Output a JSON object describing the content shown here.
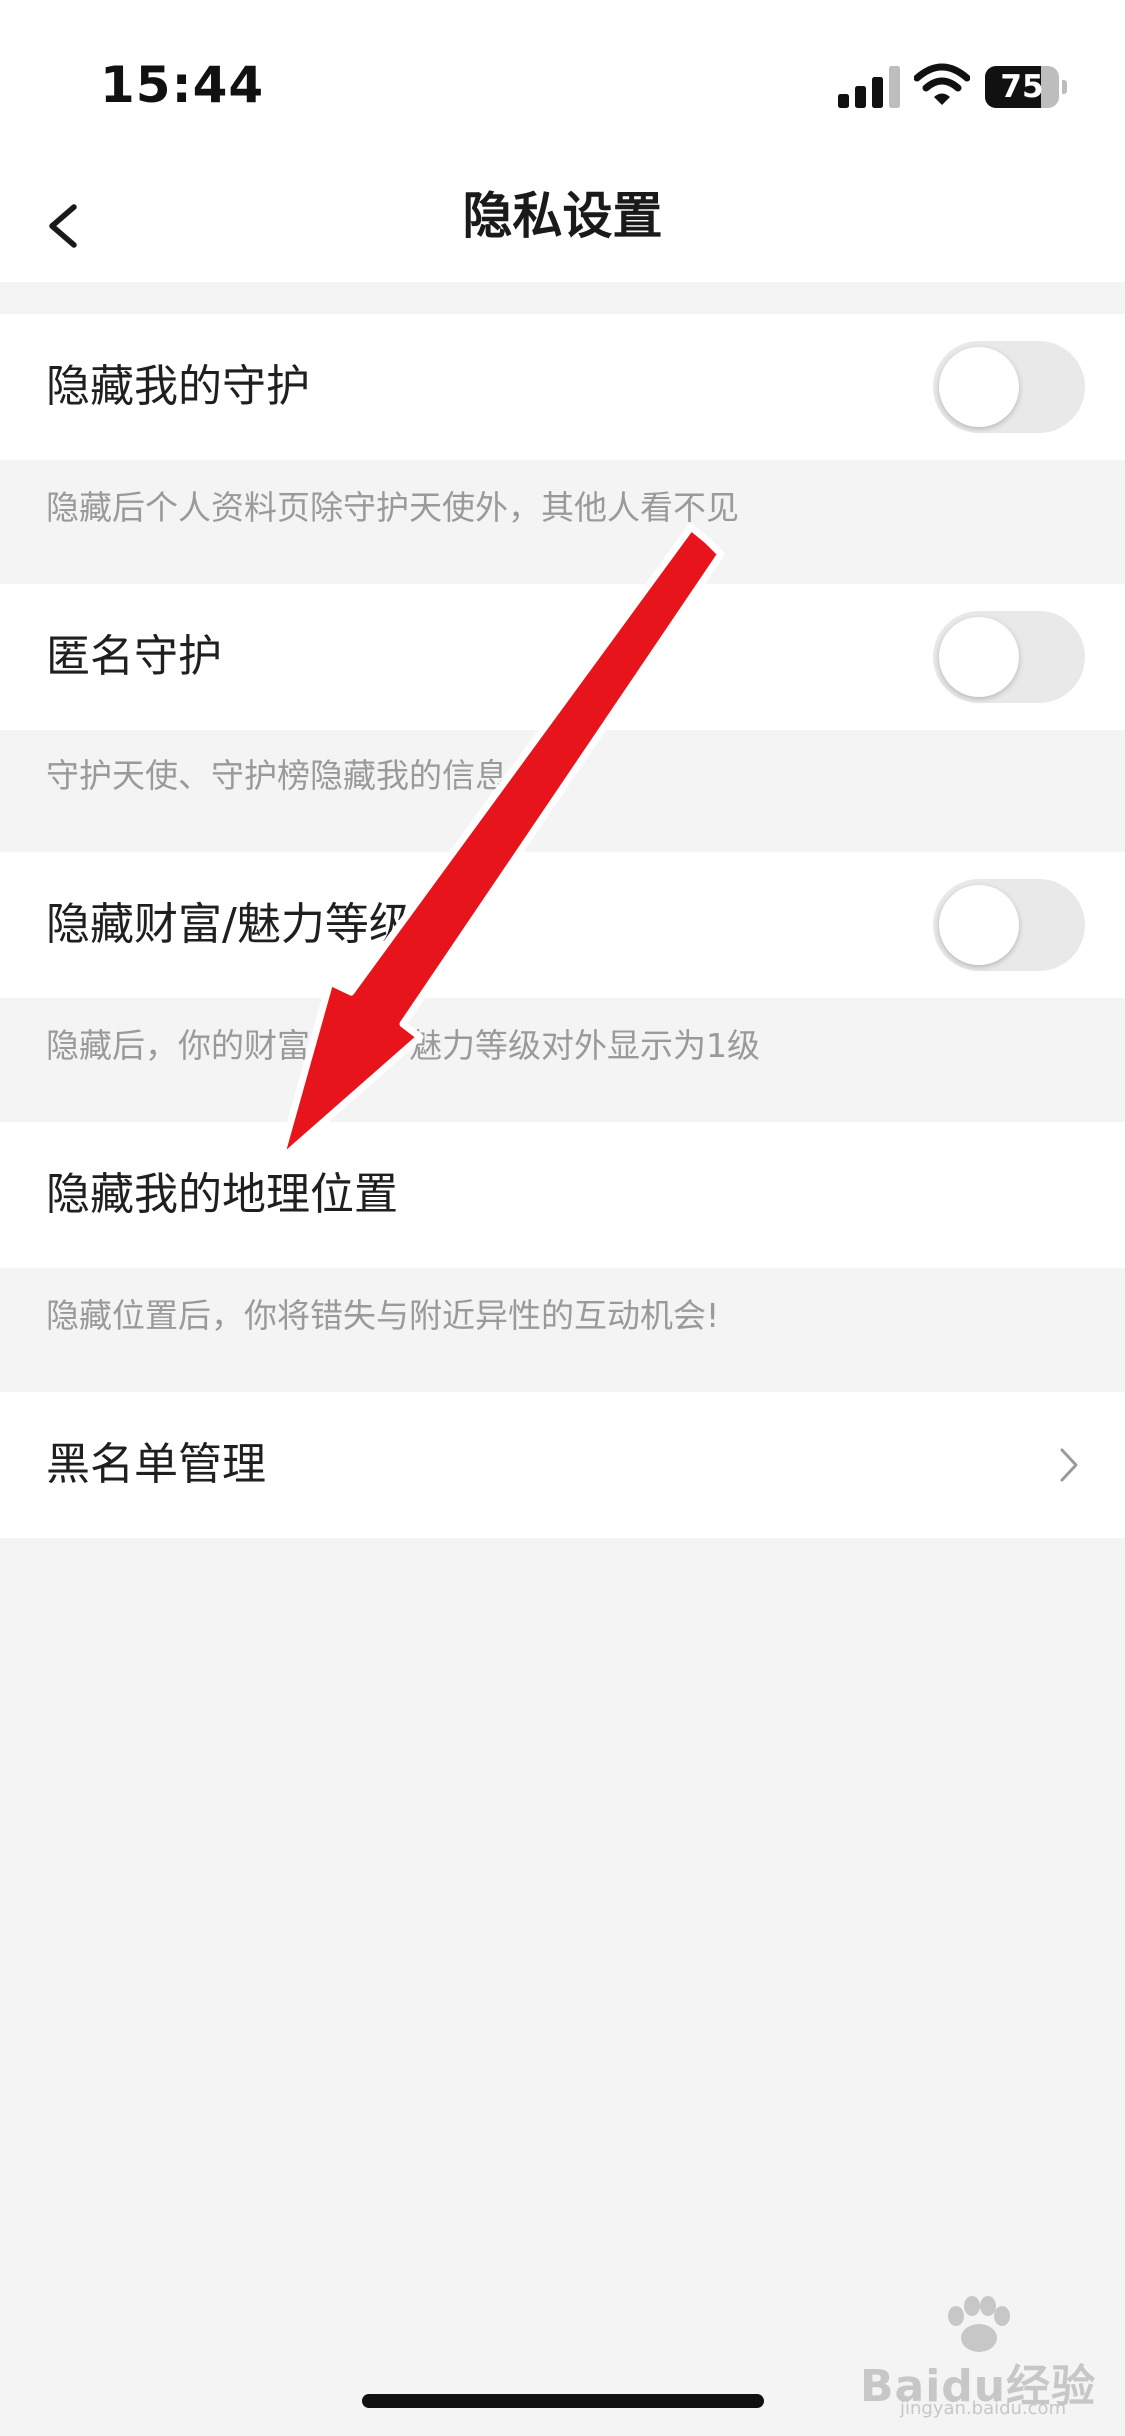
{
  "status_bar": {
    "time": "15:44",
    "battery_text": "75",
    "battery_level": 0.75
  },
  "nav": {
    "title": "隐私设置",
    "back_icon": "chevron-left-icon"
  },
  "settings": [
    {
      "label": "隐藏我的守护",
      "hint": "隐藏后个人资料页除守护天使外，其他人看不见",
      "toggle_on": false
    },
    {
      "label": "匿名守护",
      "hint": "守护天使、守护榜隐藏我的信息",
      "toggle_on": false
    },
    {
      "label": "隐藏财富/魅力等级",
      "hint": "隐藏后，你的财富等级、魅力等级对外显示为1级",
      "toggle_on": false
    },
    {
      "label": "隐藏我的地理位置",
      "hint": "隐藏位置后，你将错失与附近异性的互动机会!"
    },
    {
      "label": "黑名单管理"
    }
  ],
  "colors": {
    "background": "#f4f4f4",
    "row": "#ffffff",
    "hint_text": "#9a9a9a",
    "toggle_off": "#e9e9e9",
    "annotation_arrow": "#e8141b"
  },
  "watermark": {
    "text": "Baidu经验",
    "sub": "jingyan.baidu.com"
  }
}
